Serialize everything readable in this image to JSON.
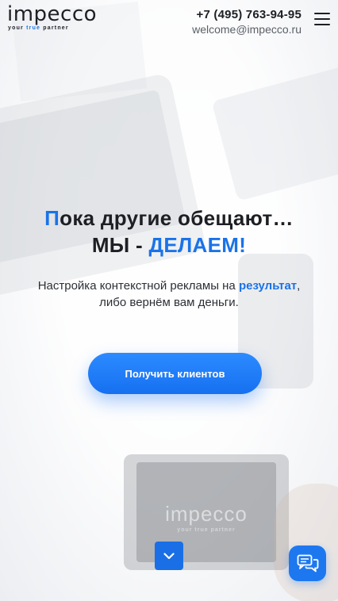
{
  "header": {
    "logo_text": "impecco",
    "logo_tag_pre": "your ",
    "logo_tag_hl": "true",
    "logo_tag_post": " partner",
    "phone": "+7 (495) 763-94-95",
    "email": "welcome@impecco.ru"
  },
  "hero": {
    "line1_first": "П",
    "line1_rest": "ока другие обещают…",
    "line2_pre": "МЫ - ",
    "line2_accent": "ДЕЛАЕМ!",
    "sub_line1_pre": "Настройка контекстной рекламы на ",
    "sub_line1_accent": "результат",
    "sub_line1_post": ",",
    "sub_line2": "либо вернём вам деньги.",
    "cta_label": "Получить клиентов"
  },
  "background": {
    "tablet_logo": "impecco",
    "tablet_tag": "your true partner"
  },
  "icons": {
    "menu": "hamburger-icon",
    "scroll": "chevron-down-icon",
    "chat": "chat-bubbles-icon"
  },
  "colors": {
    "accent": "#1a73e8",
    "text": "#1d1f24",
    "cta": "#1670f0"
  }
}
